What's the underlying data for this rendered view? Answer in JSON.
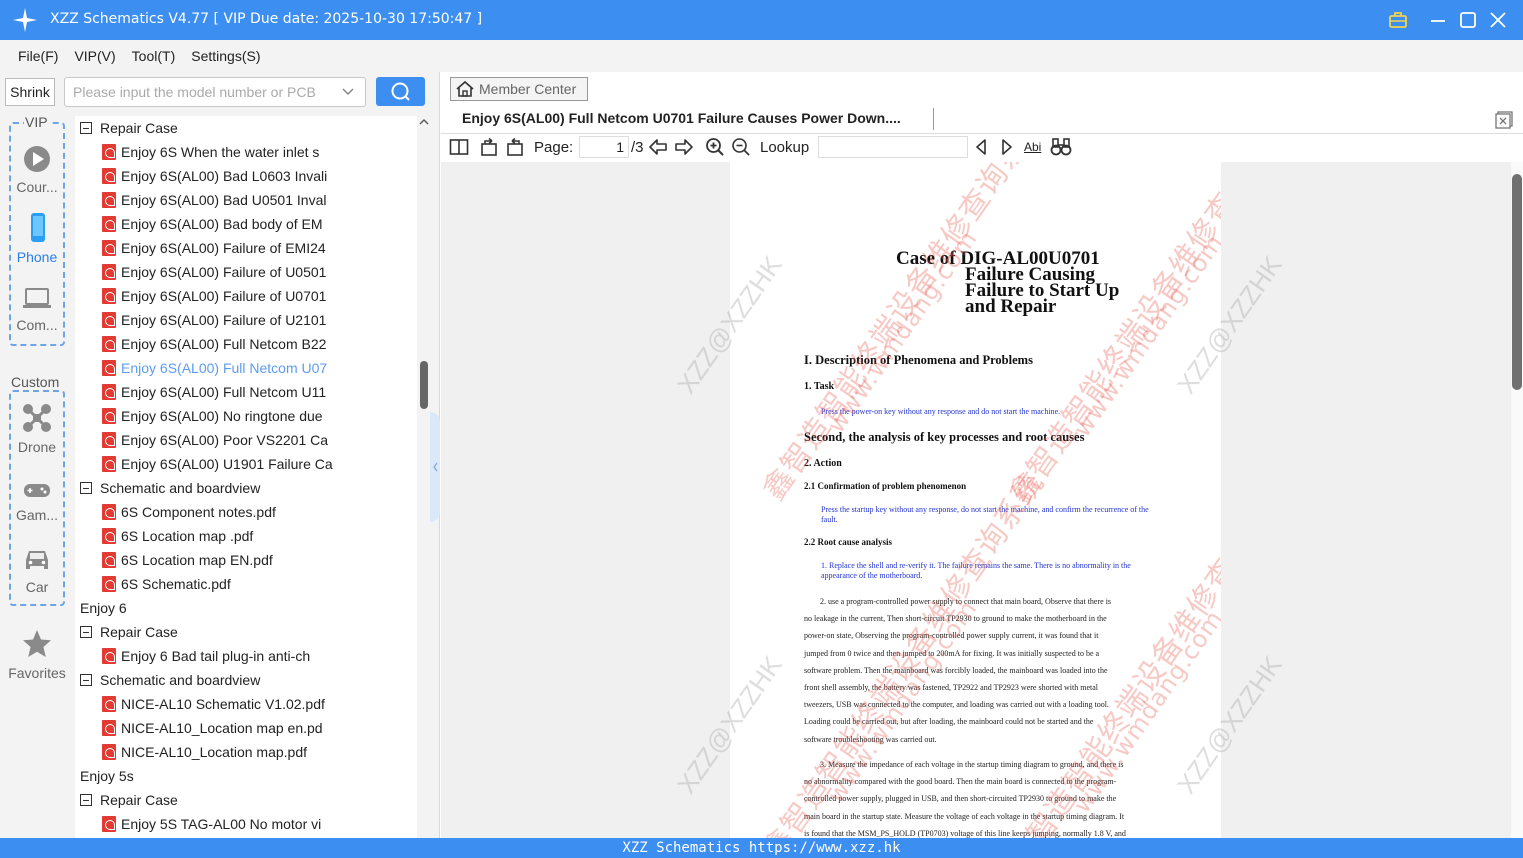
{
  "window": {
    "title": "XZZ Schematics V4.77 [ VIP Due date: 2025-10-30 17:50:47 ]"
  },
  "menu": [
    "File(F)",
    "VIP(V)",
    "Tool(T)",
    "Settings(S)"
  ],
  "search": {
    "shrink_label": "Shrink",
    "placeholder": "Please input the model number or PCB"
  },
  "categories": {
    "vip_label": "VIP",
    "custom_label": "Custom",
    "items": [
      "Cour...",
      "Phone",
      "Com...",
      "Drone",
      "Gam...",
      "Car"
    ],
    "favorites": "Favorites"
  },
  "tree": [
    {
      "type": "folder",
      "text": "Repair Case"
    },
    {
      "type": "file",
      "text": "Enjoy 6S When the water inlet s"
    },
    {
      "type": "file",
      "text": "Enjoy 6S(AL00) Bad L0603 Invali"
    },
    {
      "type": "file",
      "text": "Enjoy 6S(AL00) Bad U0501 Inval"
    },
    {
      "type": "file",
      "text": "Enjoy 6S(AL00) Bad body of EM"
    },
    {
      "type": "file",
      "text": "Enjoy 6S(AL00) Failure of EMI24"
    },
    {
      "type": "file",
      "text": "Enjoy 6S(AL00) Failure of U0501"
    },
    {
      "type": "file",
      "text": "Enjoy 6S(AL00) Failure of U0701"
    },
    {
      "type": "file",
      "text": "Enjoy 6S(AL00) Failure of U2101"
    },
    {
      "type": "file",
      "text": "Enjoy 6S(AL00) Full Netcom B22"
    },
    {
      "type": "file",
      "text": "Enjoy 6S(AL00) Full Netcom U07"
    },
    {
      "type": "file",
      "text": "Enjoy 6S(AL00) Full Netcom U11"
    },
    {
      "type": "file",
      "text": "Enjoy 6S(AL00) No ringtone due"
    },
    {
      "type": "file",
      "text": "Enjoy 6S(AL00) Poor VS2201 Ca"
    },
    {
      "type": "file",
      "text": "Enjoy 6S(AL00) U1901 Failure Ca"
    },
    {
      "type": "folder",
      "text": "Schematic and boardview"
    },
    {
      "type": "file",
      "text": "6S Component notes.pdf"
    },
    {
      "type": "file",
      "text": "6S Location map .pdf"
    },
    {
      "type": "file",
      "text": "6S Location map EN.pdf"
    },
    {
      "type": "file",
      "text": "6S Schematic.pdf"
    },
    {
      "type": "model",
      "text": "Enjoy 6"
    },
    {
      "type": "folder",
      "text": "Repair Case"
    },
    {
      "type": "file",
      "text": "Enjoy 6 Bad tail plug-in anti-ch"
    },
    {
      "type": "folder",
      "text": "Schematic and boardview"
    },
    {
      "type": "file",
      "text": "NICE-AL10 Schematic V1.02.pdf"
    },
    {
      "type": "file",
      "text": "NICE-AL10_Location map en.pd"
    },
    {
      "type": "file",
      "text": "NICE-AL10_Location map.pdf"
    },
    {
      "type": "model",
      "text": "Enjoy 5s"
    },
    {
      "type": "folder",
      "text": "Repair Case"
    },
    {
      "type": "file",
      "text": "Enjoy 5S TAG-AL00 No motor vi"
    }
  ],
  "viewer": {
    "member_center": "Member Center",
    "tab_title": "Enjoy 6S(AL00) Full Netcom U0701 Failure Causes Power Down....",
    "page_label": "Page:",
    "page_current": "1",
    "page_total": "/3",
    "lookup_label": "Lookup",
    "find_icon_text": "Abi"
  },
  "doc": {
    "title1": "Case of DIG-AL00U0701",
    "title2": "Failure Causing",
    "title3": "Failure to Start Up",
    "title4": "and Repair",
    "sec1": "I. Description of Phenomena and Problems",
    "s1_1": "1. Task",
    "s1_1_text": "Press the power-on key without any response and do not start the machine.",
    "sec2": "Second, the analysis of key processes and root causes",
    "s2": "2. Action",
    "s2_1": "2.1  Confirmation of problem phenomenon",
    "s2_1_text": "Press the startup key without any response, do not start the machine, and confirm the recurrence of the fault.",
    "s2_2": "2.2  Root cause analysis",
    "s2_2_text": "1. Replace the shell and re-verify it. The failure remains the same. There is no abnormality in the appearance of the motherboard.",
    "para2": [
      "2. use a program-controlled power supply to connect that main board, Observe that there is",
      "no leakage in the current, Then short-circuit TP2930 to ground to make the motherboard in the",
      "power-on state, Observing the program-controlled power supply current, it was found that it",
      "jumped from 0 twice and then jumped to 200mA for fixing. It was initially suspected to be a",
      "software problem. Then the mainboard was forcibly loaded, the mainboard was loaded into the",
      "front shell assembly, the battery was fastened, TP2922 and TP2923 were shorted with metal",
      "tweezers, USB was connected to the computer, and loading was carried out with a loading tool.",
      "Loading could be carried out, but after loading, the mainboard could not be started and the",
      "software troubleshooting was carried out."
    ],
    "para3": [
      "3. Measure the impedance of each voltage in the startup timing diagram to ground, and there is",
      "no abnormality compared with the good board. Then the main board is connected to the program-",
      "controlled power supply, plugged in USB, and then short-circuited TP2930 to ground to make the",
      "main board in the startup state. Measure the voltage of each voltage in the startup timing diagram. It",
      "is found that the MSM_PS_HOLD (TP0703) voltage of this line keeps jumping, normally 1.8 V, and"
    ]
  },
  "watermarks": {
    "cn": "鑫智造智能终端设备维修查询系统",
    "url": "www.wmdang.com",
    "brand": "XZZ@XZZHK"
  },
  "status_text": "XZZ Schematics https://www.xzz.hk",
  "colors": {
    "accent": "#3c8ef0",
    "selected": "#5c9cf0",
    "pdf": "#e23b33"
  }
}
